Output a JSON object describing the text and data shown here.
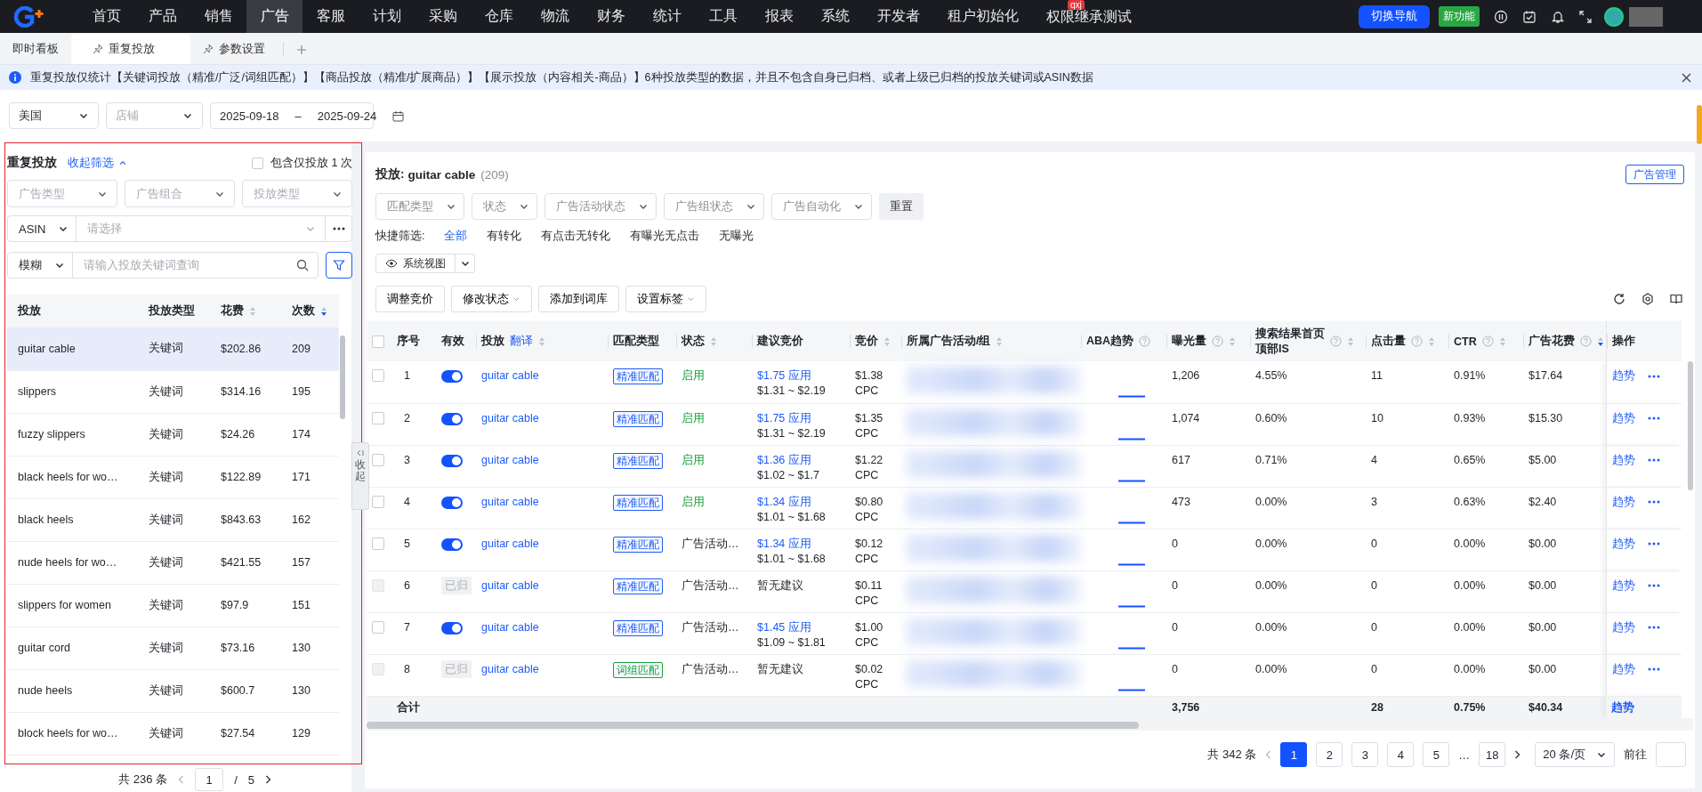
{
  "nav": {
    "items": [
      {
        "label": "首页",
        "selected": false
      },
      {
        "label": "产品",
        "selected": false
      },
      {
        "label": "销售",
        "selected": false
      },
      {
        "label": "广告",
        "selected": true
      },
      {
        "label": "客服",
        "selected": false
      },
      {
        "label": "计划",
        "selected": false
      },
      {
        "label": "采购",
        "selected": false
      },
      {
        "label": "仓库",
        "selected": false
      },
      {
        "label": "物流",
        "selected": false
      },
      {
        "label": "财务",
        "selected": false
      },
      {
        "label": "统计",
        "selected": false
      },
      {
        "label": "工具",
        "selected": false
      },
      {
        "label": "报表",
        "selected": false
      },
      {
        "label": "系统",
        "selected": false
      },
      {
        "label": "开发者",
        "selected": false
      },
      {
        "label": "租户初始化",
        "selected": false
      },
      {
        "label": "权限继承测试",
        "selected": false,
        "badge": "qxj"
      }
    ],
    "switch_button": "切换导航",
    "new_button": "新功能"
  },
  "tabs": [
    {
      "label": "即时看板",
      "pinned": false,
      "selected": false
    },
    {
      "label": "重复投放",
      "pinned": true,
      "selected": true
    },
    {
      "label": "参数设置",
      "pinned": true,
      "selected": false
    }
  ],
  "notice": {
    "text": "重复投放仅统计【关键词投放（精准/广泛/词组匹配）】【商品投放（精准/扩展商品）】【展示投放（内容相关-商品）】6种投放类型的数据，并且不包含自身已归档、或者上级已归档的投放关键词或ASIN数据"
  },
  "filters": {
    "country": "美国",
    "shop": {
      "placeholder": "店铺"
    },
    "date_start": "2025-09-18",
    "date_sep": "–",
    "date_end": "2025-09-24"
  },
  "left": {
    "title": "重复投放",
    "collapse_link": "收起筛选",
    "include_once": {
      "label": "包含仅投放 1 次",
      "checked": false
    },
    "selects": [
      {
        "placeholder": "广告类型"
      },
      {
        "placeholder": "广告组合"
      },
      {
        "placeholder": "投放类型"
      }
    ],
    "asin": {
      "mode": "ASIN",
      "placeholder": "请选择"
    },
    "search": {
      "mode": "模糊",
      "placeholder": "请输入投放关键词查询"
    },
    "columns": [
      {
        "label": "投放",
        "sortable": false
      },
      {
        "label": "投放类型",
        "sortable": false
      },
      {
        "label": "花费",
        "sortable": true,
        "sorted_desc": false
      },
      {
        "label": "次数",
        "sortable": true,
        "sorted_desc": true
      }
    ],
    "rows": [
      {
        "keyword": "guitar cable",
        "type": "关键词",
        "spend": "$202.86",
        "count": "209",
        "selected": true
      },
      {
        "keyword": "slippers",
        "type": "关键词",
        "spend": "$314.16",
        "count": "195",
        "selected": false
      },
      {
        "keyword": "fuzzy slippers",
        "type": "关键词",
        "spend": "$24.26",
        "count": "174",
        "selected": false
      },
      {
        "keyword": "black heels for wo…",
        "type": "关键词",
        "spend": "$122.89",
        "count": "171",
        "selected": false
      },
      {
        "keyword": "black heels",
        "type": "关键词",
        "spend": "$843.63",
        "count": "162",
        "selected": false
      },
      {
        "keyword": "nude heels for wo…",
        "type": "关键词",
        "spend": "$421.55",
        "count": "157",
        "selected": false
      },
      {
        "keyword": "slippers for women",
        "type": "关键词",
        "spend": "$97.9",
        "count": "151",
        "selected": false
      },
      {
        "keyword": "guitar cord",
        "type": "关键词",
        "spend": "$73.16",
        "count": "130",
        "selected": false
      },
      {
        "keyword": "nude heels",
        "type": "关键词",
        "spend": "$600.7",
        "count": "130",
        "selected": false
      },
      {
        "keyword": "block heels for wo…",
        "type": "关键词",
        "spend": "$27.54",
        "count": "129",
        "selected": false
      }
    ],
    "pagination": {
      "total": "共 236 条",
      "page": "1",
      "sep": "/",
      "pages": "5"
    }
  },
  "collapse_handle": "收起",
  "right": {
    "title_label": "投放:",
    "title_value": "guitar cable",
    "count": "(209)",
    "manage_button": "广告管理",
    "selects": [
      {
        "placeholder": "匹配类型"
      },
      {
        "placeholder": "状态"
      },
      {
        "placeholder": "广告活动状态"
      },
      {
        "placeholder": "广告组状态"
      },
      {
        "placeholder": "广告自动化"
      }
    ],
    "reset_button": "重置",
    "quick_label": "快捷筛选:",
    "quick_filters": [
      {
        "label": "全部",
        "selected": true
      },
      {
        "label": "有转化",
        "selected": false
      },
      {
        "label": "有点击无转化",
        "selected": false
      },
      {
        "label": "有曝光无点击",
        "selected": false
      },
      {
        "label": "无曝光",
        "selected": false
      }
    ],
    "view_button": "系统视图",
    "actions": [
      {
        "label": "调整竞价",
        "dropdown": false
      },
      {
        "label": "修改状态",
        "dropdown": true
      },
      {
        "label": "添加到词库",
        "dropdown": false
      },
      {
        "label": "设置标签",
        "dropdown": true
      }
    ],
    "select_all": {
      "checked": false
    },
    "columns": [
      {
        "label": "序号",
        "help": false,
        "sortable": false
      },
      {
        "label": "有效",
        "help": false,
        "sortable": false
      },
      {
        "label": "投放",
        "link": "翻译",
        "help": false,
        "sortable": true,
        "sorted_desc": false
      },
      {
        "label": "匹配类型",
        "help": false,
        "sortable": false
      },
      {
        "label": "状态",
        "help": false,
        "sortable": true,
        "sorted_desc": false
      },
      {
        "label": "建议竞价",
        "help": false,
        "sortable": false
      },
      {
        "label": "竞价",
        "help": false,
        "sortable": true,
        "sorted_desc": false
      },
      {
        "label": "所属广告活动/组",
        "help": false,
        "sortable": true,
        "sorted_desc": false
      },
      {
        "label": "ABA趋势",
        "help": true,
        "sortable": false
      },
      {
        "label": "曝光量",
        "help": true,
        "sortable": true,
        "sorted_desc": false
      },
      {
        "label": "搜索结果首页顶部IS",
        "help": true,
        "sortable": true,
        "sorted_desc": false
      },
      {
        "label": "点击量",
        "help": true,
        "sortable": true,
        "sorted_desc": false
      },
      {
        "label": "CTR",
        "help": true,
        "sortable": true,
        "sorted_desc": false
      },
      {
        "label": "广告花费",
        "help": true,
        "sortable": true,
        "sorted_desc": true
      },
      {
        "label": "操作",
        "help": false,
        "sortable": false
      }
    ],
    "rows": [
      {
        "checked": false,
        "disabled": false,
        "index": "1",
        "kind": "toggle",
        "on": true,
        "keyword": "guitar cable",
        "match": {
          "text": "精准匹配",
          "color": "#1f5cf5"
        },
        "status": {
          "text": "启用",
          "active": true
        },
        "suggest": {
          "kind": "bid",
          "bid": "$1.75",
          "apply": "应用",
          "range": "$1.31 ~ $2.19"
        },
        "bid": "$1.38",
        "bid_unit": "CPC",
        "impressions": "1,206",
        "top_is": "4.55%",
        "clicks": "11",
        "ctr": "0.91%",
        "spend": "$17.64",
        "trend": "趋势"
      },
      {
        "checked": false,
        "disabled": false,
        "index": "2",
        "kind": "toggle",
        "on": true,
        "keyword": "guitar cable",
        "match": {
          "text": "精准匹配",
          "color": "#1f5cf5"
        },
        "status": {
          "text": "启用",
          "active": true
        },
        "suggest": {
          "kind": "bid",
          "bid": "$1.75",
          "apply": "应用",
          "range": "$1.31 ~ $2.19"
        },
        "bid": "$1.35",
        "bid_unit": "CPC",
        "impressions": "1,074",
        "top_is": "0.60%",
        "clicks": "10",
        "ctr": "0.93%",
        "spend": "$15.30",
        "trend": "趋势"
      },
      {
        "checked": false,
        "disabled": false,
        "index": "3",
        "kind": "toggle",
        "on": true,
        "keyword": "guitar cable",
        "match": {
          "text": "精准匹配",
          "color": "#1f5cf5"
        },
        "status": {
          "text": "启用",
          "active": true
        },
        "suggest": {
          "kind": "bid",
          "bid": "$1.36",
          "apply": "应用",
          "range": "$1.02 ~ $1.7"
        },
        "bid": "$1.22",
        "bid_unit": "CPC",
        "impressions": "617",
        "top_is": "0.71%",
        "clicks": "4",
        "ctr": "0.65%",
        "spend": "$5.00",
        "trend": "趋势"
      },
      {
        "checked": false,
        "disabled": false,
        "index": "4",
        "kind": "toggle",
        "on": true,
        "keyword": "guitar cable",
        "match": {
          "text": "精准匹配",
          "color": "#1f5cf5"
        },
        "status": {
          "text": "启用",
          "active": true
        },
        "suggest": {
          "kind": "bid",
          "bid": "$1.34",
          "apply": "应用",
          "range": "$1.01 ~ $1.68"
        },
        "bid": "$0.80",
        "bid_unit": "CPC",
        "impressions": "473",
        "top_is": "0.00%",
        "clicks": "3",
        "ctr": "0.63%",
        "spend": "$2.40",
        "trend": "趋势"
      },
      {
        "checked": false,
        "disabled": false,
        "index": "5",
        "kind": "toggle",
        "on": true,
        "keyword": "guitar cable",
        "match": {
          "text": "精准匹配",
          "color": "#1f5cf5"
        },
        "status": {
          "text": "广告活动…",
          "active": false
        },
        "suggest": {
          "kind": "bid",
          "bid": "$1.34",
          "apply": "应用",
          "range": "$1.01 ~ $1.68"
        },
        "bid": "$0.12",
        "bid_unit": "CPC",
        "impressions": "0",
        "top_is": "0.00%",
        "clicks": "0",
        "ctr": "0.00%",
        "spend": "$0.00",
        "trend": "趋势"
      },
      {
        "checked": false,
        "disabled": true,
        "index": "6",
        "kind": "archived",
        "label": "已归",
        "keyword": "guitar cable",
        "match": {
          "text": "精准匹配",
          "color": "#1f5cf5"
        },
        "status": {
          "text": "广告活动…",
          "active": false
        },
        "suggest": {
          "kind": "none",
          "text": "暂无建议"
        },
        "bid": "$0.11",
        "bid_unit": "CPC",
        "impressions": "0",
        "top_is": "0.00%",
        "clicks": "0",
        "ctr": "0.00%",
        "spend": "$0.00",
        "trend": "趋势"
      },
      {
        "checked": false,
        "disabled": false,
        "index": "7",
        "kind": "toggle",
        "on": true,
        "keyword": "guitar cable",
        "match": {
          "text": "精准匹配",
          "color": "#1f5cf5"
        },
        "status": {
          "text": "广告活动…",
          "active": false
        },
        "suggest": {
          "kind": "bid",
          "bid": "$1.45",
          "apply": "应用",
          "range": "$1.09 ~ $1.81"
        },
        "bid": "$1.00",
        "bid_unit": "CPC",
        "impressions": "0",
        "top_is": "0.00%",
        "clicks": "0",
        "ctr": "0.00%",
        "spend": "$0.00",
        "trend": "趋势"
      },
      {
        "checked": false,
        "disabled": true,
        "index": "8",
        "kind": "archived",
        "label": "已归",
        "keyword": "guitar cable",
        "match": {
          "text": "词组匹配",
          "color": "#19a33a"
        },
        "status": {
          "text": "广告活动…",
          "active": false
        },
        "suggest": {
          "kind": "none",
          "text": "暂无建议"
        },
        "bid": "$0.02",
        "bid_unit": "CPC",
        "impressions": "0",
        "top_is": "0.00%",
        "clicks": "0",
        "ctr": "0.00%",
        "spend": "$0.00",
        "trend": "趋势"
      }
    ],
    "summary": {
      "label": "合计",
      "impressions": "3,756",
      "clicks": "28",
      "ctr": "0.75%",
      "spend": "$40.34",
      "trend": "趋势"
    },
    "pagination": {
      "total": "共 342 条",
      "pages": [
        {
          "label": "1",
          "selected": true
        },
        {
          "label": "2",
          "selected": false
        },
        {
          "label": "3",
          "selected": false
        },
        {
          "label": "4",
          "selected": false
        },
        {
          "label": "5",
          "selected": false
        }
      ],
      "ellipsis": "…",
      "last": "18",
      "page_size": "20 条/页",
      "goto": "前往"
    }
  }
}
